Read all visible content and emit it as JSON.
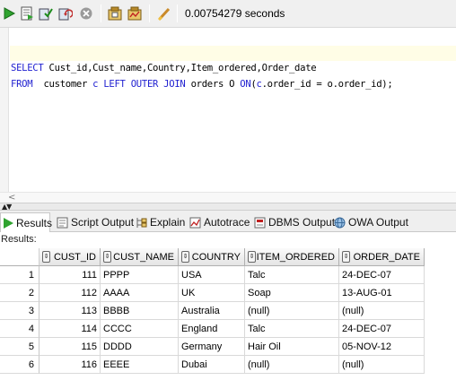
{
  "toolbar": {
    "buttons": [
      {
        "name": "run-statement-icon"
      },
      {
        "name": "run-script-icon"
      },
      {
        "name": "commit-icon"
      },
      {
        "name": "rollback-icon"
      },
      {
        "name": "cancel-icon"
      },
      {
        "name": "sql-tuning-icon"
      },
      {
        "name": "autotrace-icon"
      },
      {
        "name": "clear-icon"
      }
    ],
    "timing": "0.00754279 seconds"
  },
  "editor": {
    "line1": {
      "kw1": "SELECT",
      "rest": " Cust_id,Cust_name,Country,Item_ordered,Order_date"
    },
    "line2": {
      "kw1": "FROM",
      "t1": "  customer ",
      "alias1": "c",
      "sp1": " ",
      "kw2": "LEFT OUTER JOIN",
      "t2": " orders ",
      "alias2": "O",
      "sp2": " ",
      "kw3": "ON",
      "t3": "(",
      "alias3": "c",
      "t4": ".order_id = o.order_id);"
    }
  },
  "tabs": [
    {
      "label": "Results",
      "icon": "play-icon",
      "active": true
    },
    {
      "label": "Script Output",
      "icon": "script-output-icon",
      "active": false
    },
    {
      "label": "Explain",
      "icon": "explain-icon",
      "active": false
    },
    {
      "label": "Autotrace",
      "icon": "autotrace-icon",
      "active": false
    },
    {
      "label": "DBMS Output",
      "icon": "dbms-output-icon",
      "active": false
    },
    {
      "label": "OWA Output",
      "icon": "owa-output-icon",
      "active": false
    }
  ],
  "results_label": "Results:",
  "table": {
    "columns": [
      "CUST_ID",
      "CUST_NAME",
      "COUNTRY",
      "ITEM_ORDERED",
      "ORDER_DATE"
    ],
    "rows": [
      {
        "rn": "1",
        "cells": [
          "111",
          "PPPP",
          "USA",
          "Talc",
          "24-DEC-07"
        ]
      },
      {
        "rn": "2",
        "cells": [
          "112",
          "AAAA",
          "UK",
          "Soap",
          "13-AUG-01"
        ]
      },
      {
        "rn": "3",
        "cells": [
          "113",
          "BBBB",
          "Australia",
          "(null)",
          "(null)"
        ]
      },
      {
        "rn": "4",
        "cells": [
          "114",
          "CCCC",
          "England",
          "Talc",
          "24-DEC-07"
        ]
      },
      {
        "rn": "5",
        "cells": [
          "115",
          "DDDD",
          "Germany",
          "Hair Oil",
          "05-NOV-12"
        ]
      },
      {
        "rn": "6",
        "cells": [
          "116",
          "EEEE",
          "Dubai",
          "(null)",
          "(null)"
        ]
      }
    ]
  },
  "colors": {
    "keyword": "#1f1fd0",
    "current_line": "#fffde6"
  }
}
